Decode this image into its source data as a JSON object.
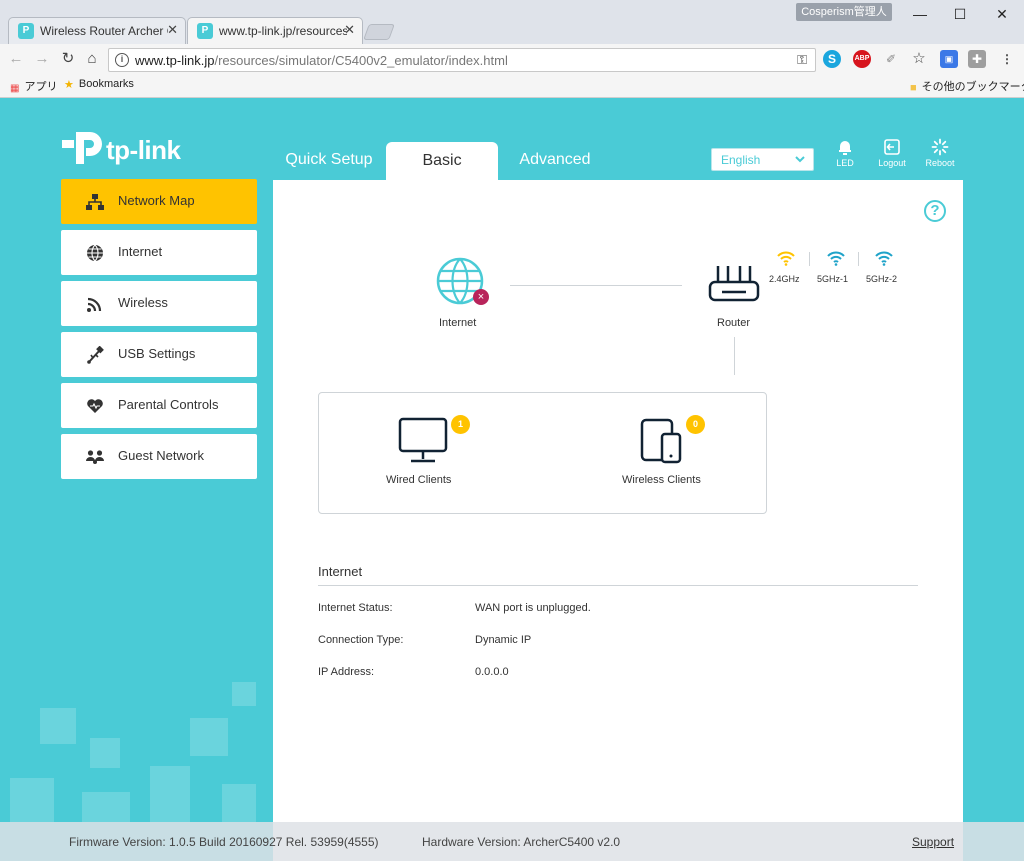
{
  "browser": {
    "tabs": [
      {
        "title": "Wireless Router Archer C",
        "active": false
      },
      {
        "title": "www.tp-link.jp/resources",
        "active": true
      }
    ],
    "profile": "Cosperism管理人",
    "url_host": "www.tp-link.jp",
    "url_path": "/resources/simulator/C5400v2_emulator/index.html",
    "bookmarks": {
      "apps": "アプリ",
      "bookmarks": "Bookmarks",
      "other": "その他のブックマーク"
    }
  },
  "brand": {
    "name": "tp-link",
    "color": "#4acbd6",
    "accent": "#ffc300"
  },
  "topnav": {
    "quick_setup": "Quick Setup",
    "basic": "Basic",
    "advanced": "Advanced",
    "active": "Basic"
  },
  "language": {
    "selected": "English"
  },
  "header_buttons": {
    "led": "LED",
    "logout": "Logout",
    "reboot": "Reboot"
  },
  "sidebar": {
    "items": [
      {
        "label": "Network Map",
        "icon": "network-map-icon",
        "active": true
      },
      {
        "label": "Internet",
        "icon": "globe-icon",
        "active": false
      },
      {
        "label": "Wireless",
        "icon": "wireless-icon",
        "active": false
      },
      {
        "label": "USB Settings",
        "icon": "usb-icon",
        "active": false
      },
      {
        "label": "Parental Controls",
        "icon": "heart-icon",
        "active": false
      },
      {
        "label": "Guest Network",
        "icon": "guest-icon",
        "active": false
      }
    ]
  },
  "network_map": {
    "internet_label": "Internet",
    "internet_status_icon": "disconnected-icon",
    "router_label": "Router",
    "bands": [
      {
        "label": "2.4GHz",
        "color": "#ffc300"
      },
      {
        "label": "5GHz-1",
        "color": "#1fa3c9"
      },
      {
        "label": "5GHz-2",
        "color": "#1fa3c9"
      }
    ],
    "wired_clients": {
      "label": "Wired Clients",
      "count": "1"
    },
    "wireless_clients": {
      "label": "Wireless Clients",
      "count": "0"
    }
  },
  "internet_info": {
    "title": "Internet",
    "rows": [
      {
        "label": "Internet Status:",
        "value": "WAN port is unplugged."
      },
      {
        "label": "Connection Type:",
        "value": "Dynamic IP"
      },
      {
        "label": "IP Address:",
        "value": "0.0.0.0"
      }
    ]
  },
  "footer": {
    "firmware": "Firmware Version: 1.0.5 Build 20160927 Rel. 53959(4555)",
    "hardware": "Hardware Version: ArcherC5400 v2.0",
    "support": "Support"
  }
}
